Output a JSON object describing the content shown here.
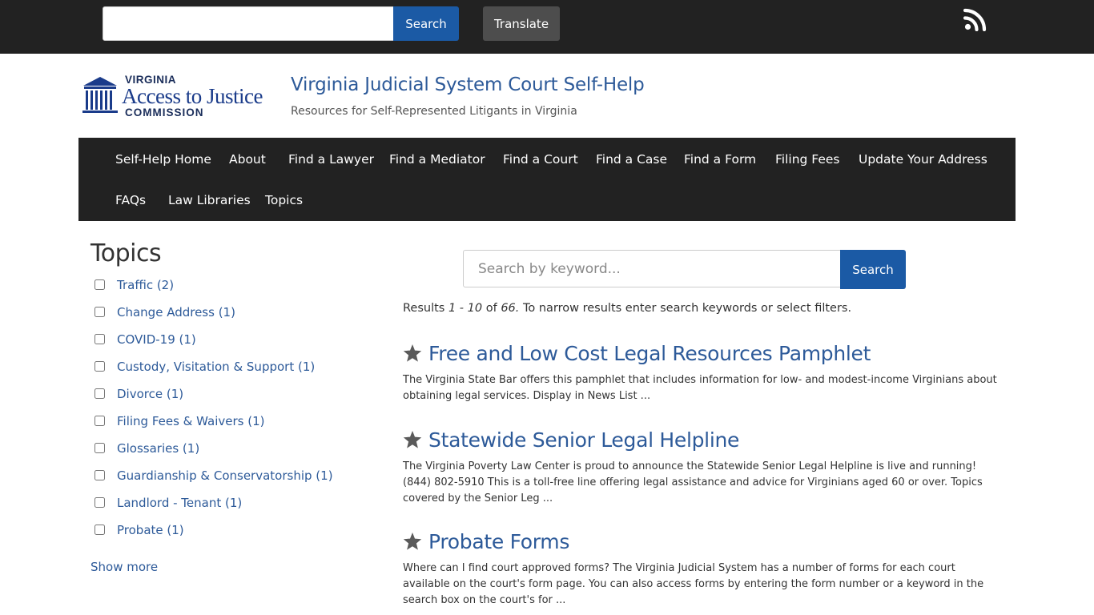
{
  "topbar": {
    "search_placeholder": "",
    "search_label": "Search",
    "translate_label": "Translate",
    "rss_icon": "rss-icon"
  },
  "header": {
    "logo_line1": "VIRGINIA",
    "logo_line2": "Access to Justice",
    "logo_line3": "COMMISSION",
    "site_title": "Virginia Judicial System Court Self-Help",
    "site_subtitle": "Resources for Self-Represented Litigants in Virginia"
  },
  "nav": {
    "items": [
      {
        "label": "Self-Help Home"
      },
      {
        "label": "About"
      },
      {
        "label": "Find a Lawyer"
      },
      {
        "label": "Find a Mediator"
      },
      {
        "label": "Find a Court"
      },
      {
        "label": "Find a Case"
      },
      {
        "label": "Find a Form"
      },
      {
        "label": "Filing Fees"
      },
      {
        "label": "Update Your Address"
      },
      {
        "label": "FAQs"
      },
      {
        "label": "Law Libraries"
      },
      {
        "label": "Topics"
      }
    ]
  },
  "sidebar": {
    "title": "Topics",
    "facets": [
      {
        "label": "Traffic (2)"
      },
      {
        "label": "Change Address (1)"
      },
      {
        "label": "COVID-19 (1)"
      },
      {
        "label": "Custody, Visitation & Support (1)"
      },
      {
        "label": "Divorce (1)"
      },
      {
        "label": "Filing Fees & Waivers (1)"
      },
      {
        "label": "Glossaries (1)"
      },
      {
        "label": "Guardianship & Conservatorship (1)"
      },
      {
        "label": "Landlord - Tenant (1)"
      },
      {
        "label": "Probate (1)"
      }
    ],
    "show_more": "Show more"
  },
  "main": {
    "search_placeholder": "Search by keyword...",
    "search_label": "Search",
    "results_prefix": "Results ",
    "results_range": "1 - 10",
    "results_of": " of ",
    "results_total": "66.",
    "results_suffix": " To narrow results enter search keywords or select filters.",
    "results": [
      {
        "title": "Free and Low Cost Legal Resources Pamphlet",
        "snippet": "The Virginia State Bar offers this  pamphlet that includes information for low- and modest-income Virginians about obtaining legal services. Display in News List ..."
      },
      {
        "title": "Statewide Senior Legal Helpline",
        "snippet": "The Virginia Poverty Law Center is proud to announce the Statewide Senior Legal Helpline is live and running!  (844) 802-5910   This is a toll-free line offering legal assistance and advice for Virginians aged 60 or over.  Topics covered by the Senior Leg ..."
      },
      {
        "title": "Probate Forms",
        "snippet": "Where can I find court approved forms? The Virginia Judicial System has a number of forms for each court available on the court's form page.  You can also access forms by entering the form number or a keyword in the search box on the court's for ..."
      }
    ]
  },
  "colors": {
    "accent_blue": "#1b5aa5",
    "link_blue": "#2d5a99",
    "dark_bar": "#222222",
    "translate_gray": "#4d4d4d"
  }
}
